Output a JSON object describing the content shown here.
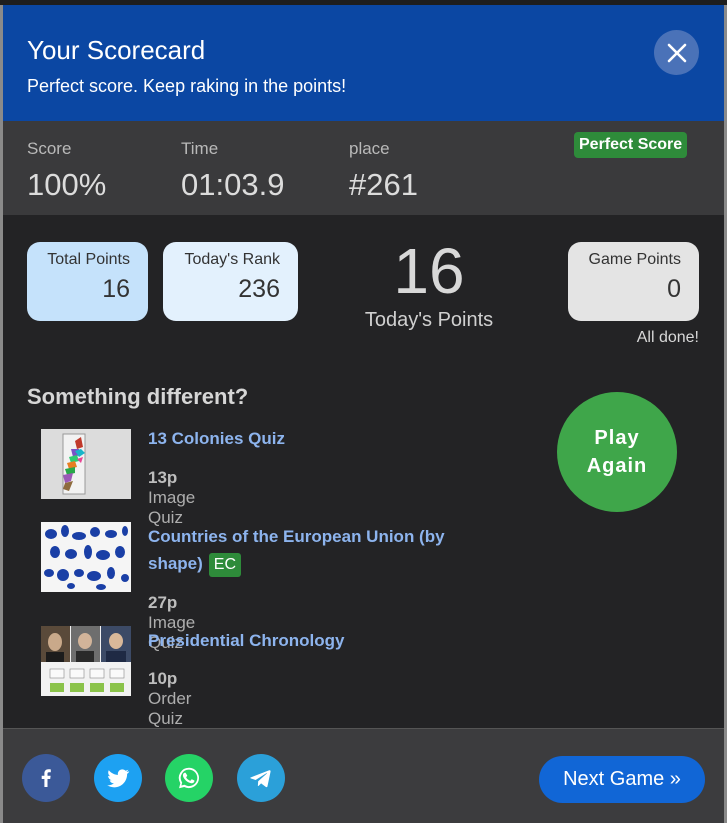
{
  "header": {
    "title": "Your Scorecard",
    "subtitle": "Perfect score. Keep raking in the points!"
  },
  "stats": {
    "score_label": "Score",
    "score_value": "100%",
    "time_label": "Time",
    "time_value": "01:03.9",
    "place_label": "place",
    "place_value": "#261",
    "badge": "Perfect Score"
  },
  "points": {
    "total_label": "Total Points",
    "total_value": "16",
    "rank_label": "Today's Rank",
    "rank_value": "236",
    "today_value": "16",
    "today_label": "Today's Points",
    "game_label": "Game Points",
    "game_value": "0",
    "status": "All done!"
  },
  "suggestions": {
    "title": "Something different?",
    "items": [
      {
        "title": "13 Colonies Quiz",
        "points": "13p",
        "type": "Image Quiz"
      },
      {
        "title": "Countries of the European Union (by shape)",
        "title_line1": "Countries of the European Union (by",
        "title_line2": "shape)",
        "badge": "EC",
        "points": "27p",
        "type": "Image Quiz"
      },
      {
        "title": "Presidential Chronology",
        "points": "10p",
        "type": "Order Quiz"
      }
    ],
    "play_again": "Play Again"
  },
  "footer": {
    "share_icons": [
      "facebook-icon",
      "twitter-icon",
      "whatsapp-icon",
      "telegram-icon"
    ],
    "next_button": "Next Game »"
  },
  "colors": {
    "header_bg": "#0b47a3",
    "badge_green": "#2e8b3a",
    "play_green": "#3fa64a",
    "link_blue": "#8db4ee",
    "next_blue": "#1166d6",
    "total_box": "#c5e2fb",
    "rank_box": "#e3f1fd",
    "game_box": "#e4e4e4"
  }
}
